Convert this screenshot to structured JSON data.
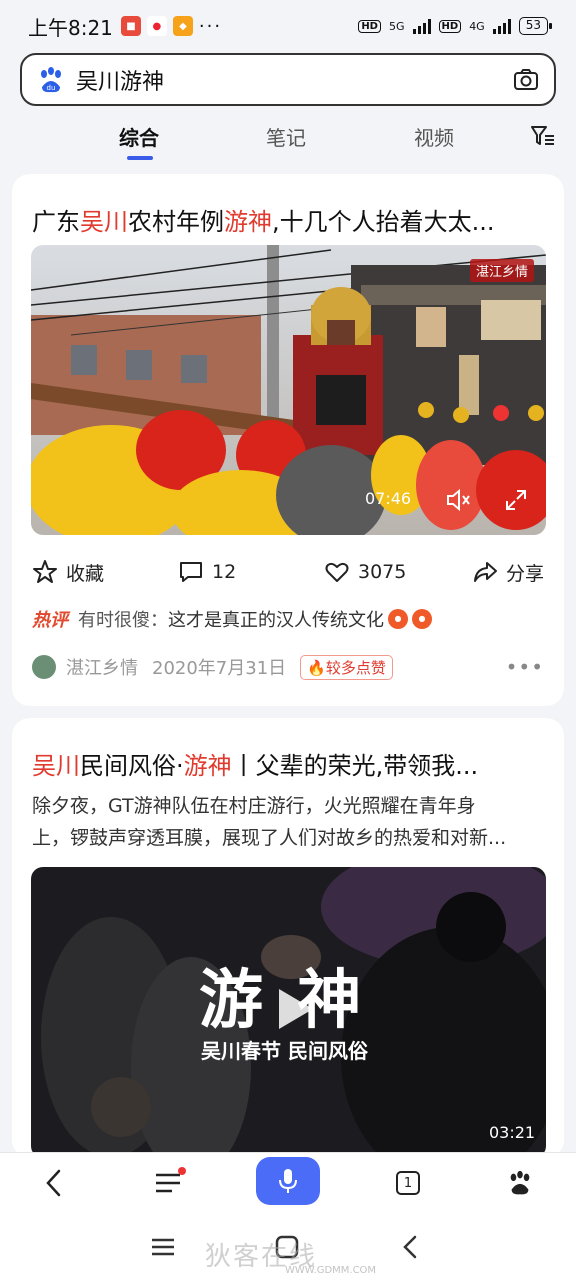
{
  "status_bar": {
    "time": "上午8:21",
    "signal1": "5G",
    "signal2": "4G",
    "hd": "HD",
    "battery": "53"
  },
  "search": {
    "query": "吴川游神"
  },
  "tabs": [
    {
      "label": "综合"
    },
    {
      "label": "笔记"
    },
    {
      "label": "视频"
    }
  ],
  "card1": {
    "title_parts": [
      "广东",
      "吴川",
      "农村年例",
      "游神",
      ",十几个人抬着大太..."
    ],
    "channel_tag": "湛江乡情",
    "duration": "07:46",
    "actions": {
      "favorite": "收藏",
      "comments": "12",
      "likes": "3075",
      "share": "分享"
    },
    "hot_comment": {
      "label": "热评",
      "user": "有时很傻：",
      "text": "这才是真正的汉人传统文化"
    },
    "source": {
      "name": "湛江乡情",
      "date": "2020年7月31日",
      "badge": "较多点赞"
    }
  },
  "card2": {
    "title_parts": [
      "吴川",
      "民间风俗·",
      "游神",
      "丨父辈的荣光,带领我..."
    ],
    "desc_line1": "除夕夜，GT游神队伍在村庄游行，火光照耀在青年身",
    "desc_line2": "上，锣鼓声穿透耳膜，展现了人们对故乡的热爱和对新...",
    "overlay_title": "游 神",
    "overlay_sub": "吴川春节 民间风俗",
    "duration": "03:21"
  },
  "bottom_nav": {
    "tab_count": "1"
  },
  "watermark": {
    "text": "狄客在线",
    "url": "WWW.GDMM.COM"
  },
  "colors": {
    "accent": "#3a5ce9",
    "highlight": "#e03b2e",
    "voice": "#4a6cf7"
  }
}
